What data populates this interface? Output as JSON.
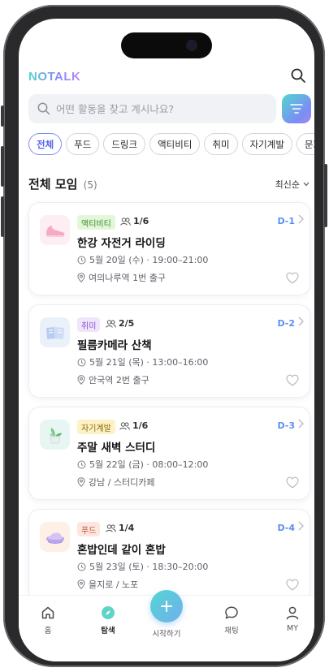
{
  "header": {
    "logo": "NOTALK"
  },
  "search": {
    "placeholder": "어떤 활동을 찾고 계시나요?"
  },
  "chips": [
    "전체",
    "푸드",
    "드링크",
    "액티비티",
    "취미",
    "자기계발",
    "문화"
  ],
  "section": {
    "title": "전체 모임",
    "count": "(5)",
    "sort": "최신순"
  },
  "cards": [
    {
      "tag": "액티비티",
      "people": "1/6",
      "dday": "D-1",
      "title": "한강 자전거 라이딩",
      "time": "5월 20일 (수) · 19:00–21:00",
      "place": "여의나루역 1번 출구"
    },
    {
      "tag": "취미",
      "people": "2/5",
      "dday": "D-2",
      "title": "필름카메라 산책",
      "time": "5월 21일 (목) · 13:00–16:00",
      "place": "안국역 2번 출구"
    },
    {
      "tag": "자기계발",
      "people": "1/6",
      "dday": "D-3",
      "title": "주말 새벽 스터디",
      "time": "5월 22일 (금) · 08:00–12:00",
      "place": "강남 / 스터디카페"
    },
    {
      "tag": "푸드",
      "people": "1/4",
      "dday": "D-4",
      "title": "혼밥인데 같이 혼밥",
      "time": "5월 23일 (토) · 18:30–20:00",
      "place": "을지로 / 노포"
    }
  ],
  "tabs": {
    "home": "홈",
    "explore": "탐색",
    "start": "시작하기",
    "chat": "채팅",
    "my": "MY"
  },
  "colors": {
    "accent": "#7b8df4",
    "teal": "#52d6cf",
    "dday": "#5b8ff0"
  }
}
